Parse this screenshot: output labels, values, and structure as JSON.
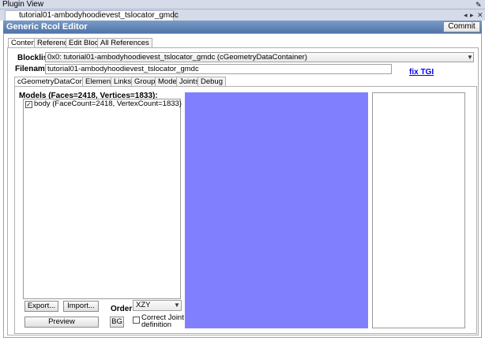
{
  "plugin": {
    "title": "Plugin View"
  },
  "doc_tab": {
    "label": "tutorial01-ambodyhoodievest_tslocator_gmdc"
  },
  "editor": {
    "title": "Generic Rcol Editor",
    "commit_label": "Commit"
  },
  "outer_tabs": [
    {
      "label": "Content",
      "active": true
    },
    {
      "label": "Reference",
      "active": false
    },
    {
      "label": "Edit Blocks",
      "active": false
    },
    {
      "label": "All References",
      "active": false
    }
  ],
  "blocklist": {
    "label": "Blocklist:",
    "value": "0x0: tutorial01-ambodyhoodievest_tslocator_gmdc (cGeometryDataContainer)"
  },
  "filename": {
    "label": "Filename:",
    "value": "tutorial01-ambodyhoodievest_tslocator_gmdc"
  },
  "fix_tgi": {
    "label": "fix TGI"
  },
  "inner_tabs": [
    {
      "label": "cGeometryDataContainer",
      "active": true
    },
    {
      "label": "Elements",
      "active": false
    },
    {
      "label": "Links",
      "active": false
    },
    {
      "label": "Groups",
      "active": false
    },
    {
      "label": "Model",
      "active": false
    },
    {
      "label": "Joints",
      "active": false
    },
    {
      "label": "Debug",
      "active": false
    }
  ],
  "models": {
    "heading": "Models (Faces=2418, Vertices=1833):",
    "items": [
      {
        "label": "body (FaceCount=2418, VertexCount=1833)",
        "checked": true
      }
    ]
  },
  "controls": {
    "export_label": "Export...",
    "import_label": "Import...",
    "order_label": "Order:",
    "order_value": "XZY",
    "preview_label": "Preview",
    "bg_label": "BG",
    "correct_joint_label_line1": "Correct Joint",
    "correct_joint_label_line2": "definition"
  },
  "colors": {
    "viewport": "#8080ff",
    "header": "#4f73a8",
    "link": "#0000ee"
  }
}
